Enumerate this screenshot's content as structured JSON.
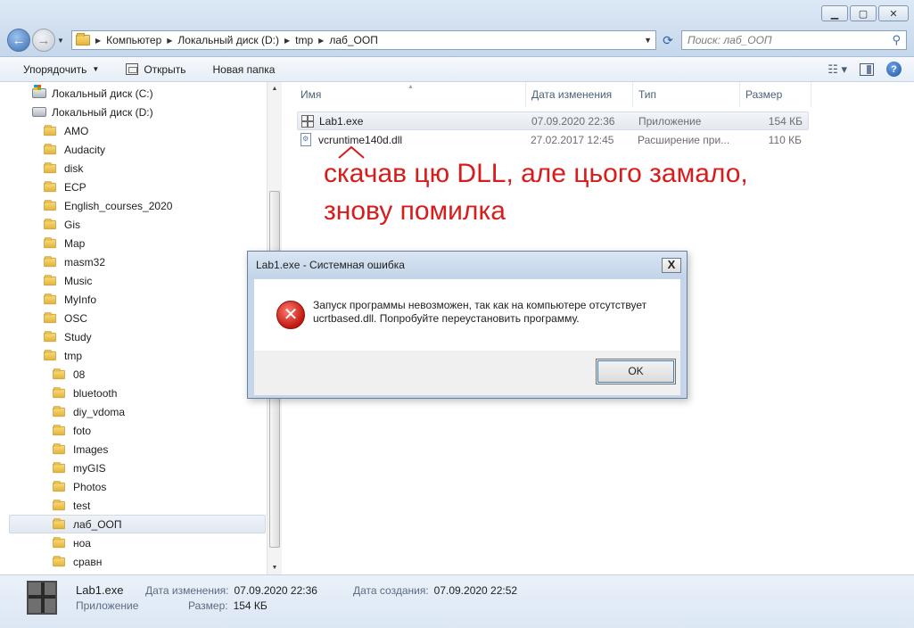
{
  "window": {
    "minimize_glyph": "▁",
    "maximize_glyph": "▢",
    "close_glyph": "✕"
  },
  "address_bar": {
    "crumbs": [
      "Компьютер",
      "Локальный диск (D:)",
      "tmp",
      "лаб_ООП"
    ]
  },
  "search": {
    "placeholder": "Поиск: лаб_ООП"
  },
  "toolbar": {
    "organize_label": "Упорядочить",
    "open_label": "Открыть",
    "new_folder_label": "Новая папка"
  },
  "nav_tree": {
    "items": [
      {
        "label": "Локальный диск (C:)"
      },
      {
        "label": "Локальный диск (D:)"
      },
      {
        "label": "AMO"
      },
      {
        "label": "Audacity"
      },
      {
        "label": "disk"
      },
      {
        "label": "ECP"
      },
      {
        "label": "English_courses_2020"
      },
      {
        "label": "Gis"
      },
      {
        "label": "Map"
      },
      {
        "label": "masm32"
      },
      {
        "label": "Music"
      },
      {
        "label": "MyInfo"
      },
      {
        "label": "OSC"
      },
      {
        "label": "Study"
      },
      {
        "label": "tmp"
      },
      {
        "label": "08"
      },
      {
        "label": "bluetooth"
      },
      {
        "label": "diy_vdoma"
      },
      {
        "label": "foto"
      },
      {
        "label": "Images"
      },
      {
        "label": "myGIS"
      },
      {
        "label": "Photos"
      },
      {
        "label": "test"
      },
      {
        "label": "лаб_ООП"
      },
      {
        "label": "ноа"
      },
      {
        "label": "сравн"
      }
    ]
  },
  "files": {
    "columns": [
      "Имя",
      "Дата изменения",
      "Тип",
      "Размер"
    ],
    "rows": [
      {
        "name": "Lab1.exe",
        "date": "07.09.2020 22:36",
        "type": "Приложение",
        "size": "154 КБ"
      },
      {
        "name": "vcruntime140d.dll",
        "date": "27.02.2017 12:45",
        "type": "Расширение при...",
        "size": "110 КБ"
      }
    ]
  },
  "annotation": {
    "line1": "скачав цю DLL, але цього замало,",
    "line2": "знову помилка",
    "color": "#d81c1c"
  },
  "dialog": {
    "title": "Lab1.exe - Системная ошибка",
    "close_glyph": "X",
    "message_line1": "Запуск программы невозможен, так как на компьютере отсутствует",
    "message_line2": "ucrtbased.dll. Попробуйте переустановить программу.",
    "ok_label": "OK"
  },
  "details": {
    "name": "Lab1.exe",
    "type": "Приложение",
    "modified_label": "Дата изменения:",
    "modified_value": "07.09.2020 22:36",
    "size_label": "Размер:",
    "size_value": "154 КБ",
    "created_label": "Дата создания:",
    "created_value": "07.09.2020 22:52"
  }
}
